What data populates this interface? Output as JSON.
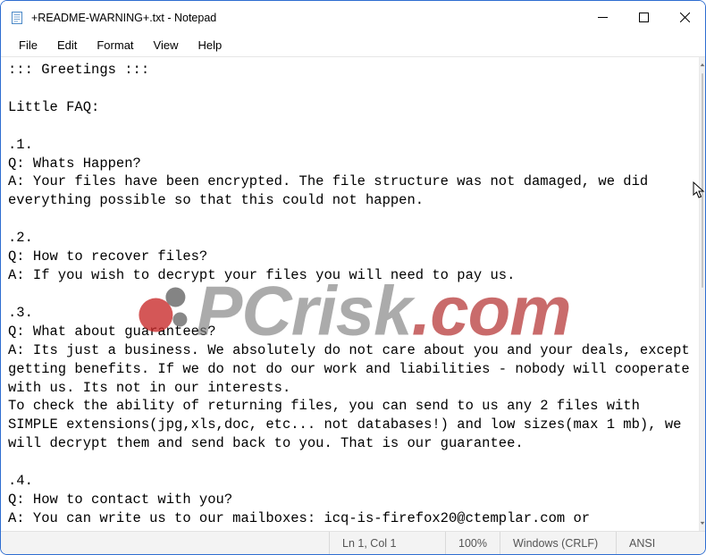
{
  "window": {
    "title": "+README-WARNING+.txt - Notepad"
  },
  "menubar": {
    "items": [
      "File",
      "Edit",
      "Format",
      "View",
      "Help"
    ]
  },
  "document": {
    "text": "::: Greetings :::\n\nLittle FAQ:\n\n.1.\nQ: Whats Happen?\nA: Your files have been encrypted. The file structure was not damaged, we did everything possible so that this could not happen.\n\n.2.\nQ: How to recover files?\nA: If you wish to decrypt your files you will need to pay us.\n\n.3.\nQ: What about guarantees?\nA: Its just a business. We absolutely do not care about you and your deals, except getting benefits. If we do not do our work and liabilities - nobody will cooperate with us. Its not in our interests.\nTo check the ability of returning files, you can send to us any 2 files with SIMPLE extensions(jpg,xls,doc, etc... not databases!) and low sizes(max 1 mb), we will decrypt them and send back to you. That is our guarantee.\n\n.4.\nQ: How to contact with you?\nA: You can write us to our mailboxes: icq-is-firefox20@ctemplar.com or"
  },
  "statusbar": {
    "position": "Ln 1, Col 1",
    "zoom": "100%",
    "line_ending": "Windows (CRLF)",
    "encoding": "ANSI"
  },
  "watermark": {
    "text_main": "PCrisk",
    "text_suffix": ".com"
  }
}
